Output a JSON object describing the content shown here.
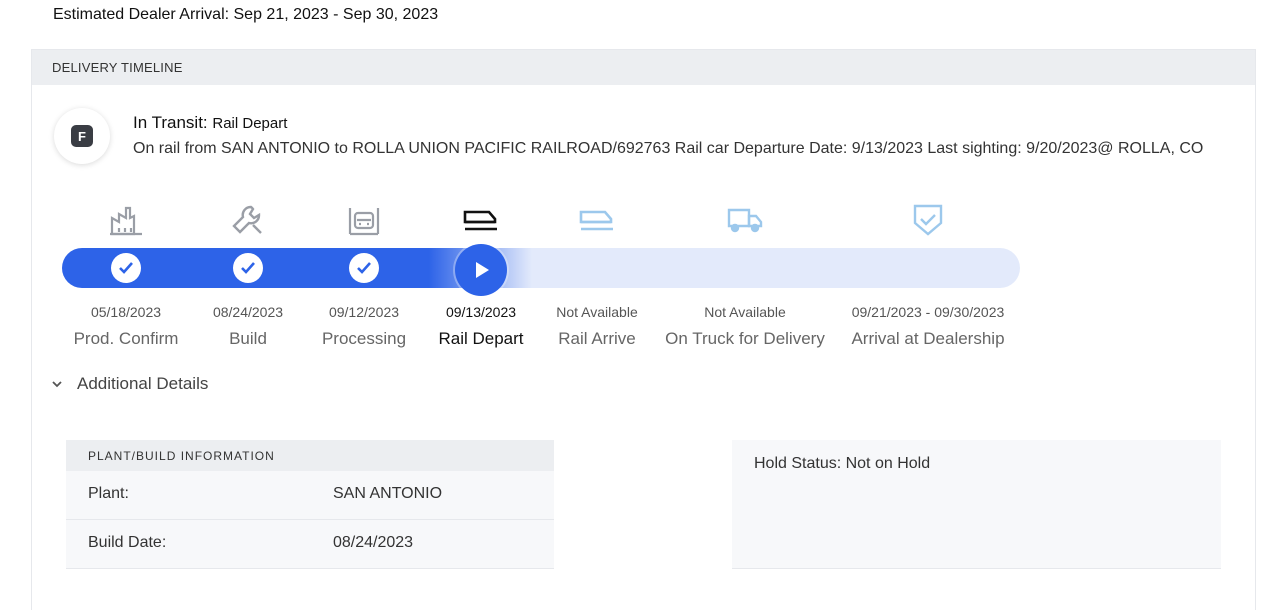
{
  "eta": "Estimated Dealer Arrival: Sep 21, 2023 - Sep 30, 2023",
  "timeline": {
    "header": "DELIVERY TIMELINE",
    "badge": "F",
    "status_label": "In Transit:",
    "status_sub": "Rail Depart",
    "status_desc": "On rail from SAN ANTONIO to ROLLA UNION PACIFIC RAILROAD/692763 Rail car Departure Date: 9/13/2023 Last sighting: 9/20/2023@ ROLLA, CO",
    "current_step": 3,
    "steps": [
      {
        "date": "05/18/2023",
        "label": "Prod. Confirm",
        "icon": "factory-icon",
        "state": "complete"
      },
      {
        "date": "08/24/2023",
        "label": "Build",
        "icon": "wrench-icon",
        "state": "complete"
      },
      {
        "date": "09/12/2023",
        "label": "Processing",
        "icon": "vehicle-processing-icon",
        "state": "complete"
      },
      {
        "date": "09/13/2023",
        "label": "Rail Depart",
        "icon": "train-icon",
        "state": "current"
      },
      {
        "date": "Not Available",
        "label": "Rail Arrive",
        "icon": "train-icon",
        "state": "pending"
      },
      {
        "date": "Not Available",
        "label": "On Truck for Delivery",
        "icon": "truck-icon",
        "state": "pending"
      },
      {
        "date": "09/21/2023 - 09/30/2023",
        "label": "Arrival at Dealership",
        "icon": "shield-check-icon",
        "state": "pending"
      }
    ]
  },
  "additional_details": {
    "toggle_label": "Additional Details",
    "plant": {
      "header": "PLANT/BUILD INFORMATION",
      "rows": [
        {
          "key": "Plant:",
          "value": "SAN ANTONIO"
        },
        {
          "key": "Build Date:",
          "value": "08/24/2023"
        }
      ]
    },
    "hold_status": "Hold Status: Not on Hold"
  },
  "colors": {
    "progress": "#2d63e8",
    "track": "#e3eafb",
    "icon_done": "#9a9ea6",
    "icon_current": "#111111",
    "icon_pending": "#9cc8ec"
  }
}
